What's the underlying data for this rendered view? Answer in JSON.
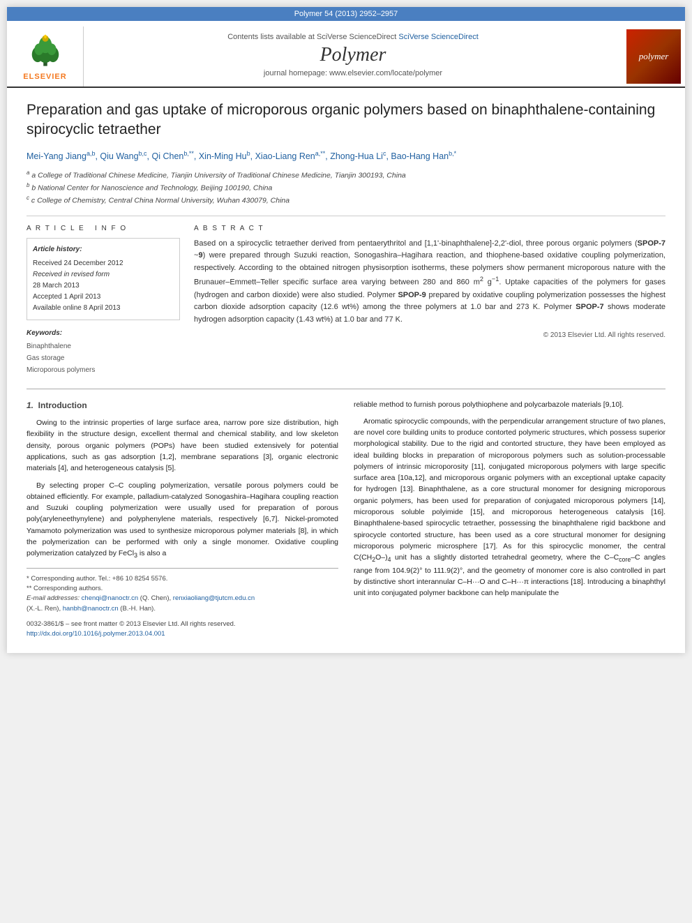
{
  "topbar": {
    "text": "Polymer 54 (2013) 2952–2957"
  },
  "header": {
    "sciverse_line": "Contents lists available at SciVerse ScienceDirect",
    "journal_name": "Polymer",
    "homepage_text": "journal homepage: www.elsevier.com/locate/polymer",
    "elsevier_label": "ELSEVIER",
    "polymer_logo_text": "polymer"
  },
  "article": {
    "title": "Preparation and gas uptake of microporous organic polymers based on binaphthalene-containing spirocyclic tetraether",
    "authors": "Mei-Yang Jiang a,b, Qiu Wang b,c, Qi Chen b,**, Xin-Ming Hu b, Xiao-Liang Ren a,**, Zhong-Hua Li c, Bao-Hang Han b,*",
    "affiliations": [
      "a College of Traditional Chinese Medicine, Tianjin University of Traditional Chinese Medicine, Tianjin 300193, China",
      "b National Center for Nanoscience and Technology, Beijing 100190, China",
      "c College of Chemistry, Central China Normal University, Wuhan 430079, China"
    ],
    "article_info": {
      "title": "Article history:",
      "received": "Received 24 December 2012",
      "received_revised": "Received in revised form 28 March 2013",
      "accepted": "Accepted 1 April 2013",
      "available": "Available online 8 April 2013"
    },
    "keywords": {
      "title": "Keywords:",
      "items": [
        "Binaphthalene",
        "Gas storage",
        "Microporous polymers"
      ]
    },
    "abstract": "Based on a spirocyclic tetraether derived from pentaerythritol and [1,1'-binaphthalene]-2,2'-diol, three porous organic polymers (SPOP-7 ~9) were prepared through Suzuki reaction, Sonogashira–Hagihara reaction, and thiophene-based oxidative coupling polymerization, respectively. According to the obtained nitrogen physisorption isotherms, these polymers show permanent microporous nature with the Brunauer–Emmett–Teller specific surface area varying between 280 and 860 m² g⁻¹. Uptake capacities of the polymers for gases (hydrogen and carbon dioxide) were also studied. Polymer SPOP-9 prepared by oxidative coupling polymerization possesses the highest carbon dioxide adsorption capacity (12.6 wt%) among the three polymers at 1.0 bar and 273 K. Polymer SPOP-7 shows moderate hydrogen adsorption capacity (1.43 wt%) at 1.0 bar and 77 K.",
    "copyright": "© 2013 Elsevier Ltd. All rights reserved.",
    "section1_title": "1.  Introduction",
    "body_col1": [
      "Owing to the intrinsic properties of large surface area, narrow pore size distribution, high flexibility in the structure design, excellent thermal and chemical stability, and low skeleton density, porous organic polymers (POPs) have been studied extensively for potential applications, such as gas adsorption [1,2], membrane separations [3], organic electronic materials [4], and heterogeneous catalysis [5].",
      "By selecting proper C–C coupling polymerization, versatile porous polymers could be obtained efficiently. For example, palladium-catalyzed Sonogashira–Hagihara coupling reaction and Suzuki coupling polymerization were usually used for preparation of porous poly(aryleneethynylene) and polyphenylene materials, respectively [6,7]. Nickel-promoted Yamamoto polymerization was used to synthesize microporous polymer materials [8], in which the polymerization can be performed with only a single monomer. Oxidative coupling polymerization catalyzed by FeCl₃ is also a"
    ],
    "body_col2": [
      "reliable method to furnish porous polythiophene and polycarbazole materials [9,10].",
      "Aromatic spirocyclic compounds, with the perpendicular arrangement structure of two planes, are novel core building units to produce contorted polymeric structures, which possess superior morphological stability. Due to the rigid and contorted structure, they have been employed as ideal building blocks in preparation of microporous polymers such as solution-processable polymers of intrinsic microporosity [11], conjugated microporous polymers with large specific surface area [10a,12], and microporous organic polymers with an exceptional uptake capacity for hydrogen [13]. Binaphthalene, as a core structural monomer for designing microporous organic polymers, has been used for preparation of conjugated microporous polymers [14], microporous soluble polyimide [15], and microporous heterogeneous catalysis [16]. Binaphthalene-based spirocyclic tetraether, possessing the binaphthalene rigid backbone and spirocycle contorted structure, has been used as a core structural monomer for designing microporous polymeric microsphere [17]. As for this spirocyclic monomer, the central C(CH₂O–)₄ unit has a slightly distorted tetrahedral geometry, where the C–Cₙₒ⭣₁–C angles range from 104.9(2)° to 111.9(2)°, and the geometry of monomer core is also controlled in part by distinctive short interannular C–H···O and C–H···π interactions [18]. Introducing a binaphthyl unit into conjugated polymer backbone can help manipulate the"
    ],
    "footnotes": {
      "corresponding1": "* Corresponding author. Tel.: +86 10 8254 5576.",
      "corresponding2": "** Corresponding authors.",
      "email": "E-mail addresses: chenqi@nanoctr.cn (Q. Chen), renxiaoliang@tjutcm.edu.cn (X.-L. Ren), hanbh@nanoctr.cn (B.-H. Han).",
      "issn": "0032-3861/$ – see front matter © 2013 Elsevier Ltd. All rights reserved.",
      "doi": "http://dx.doi.org/10.1016/j.polymer.2013.04.001"
    }
  }
}
